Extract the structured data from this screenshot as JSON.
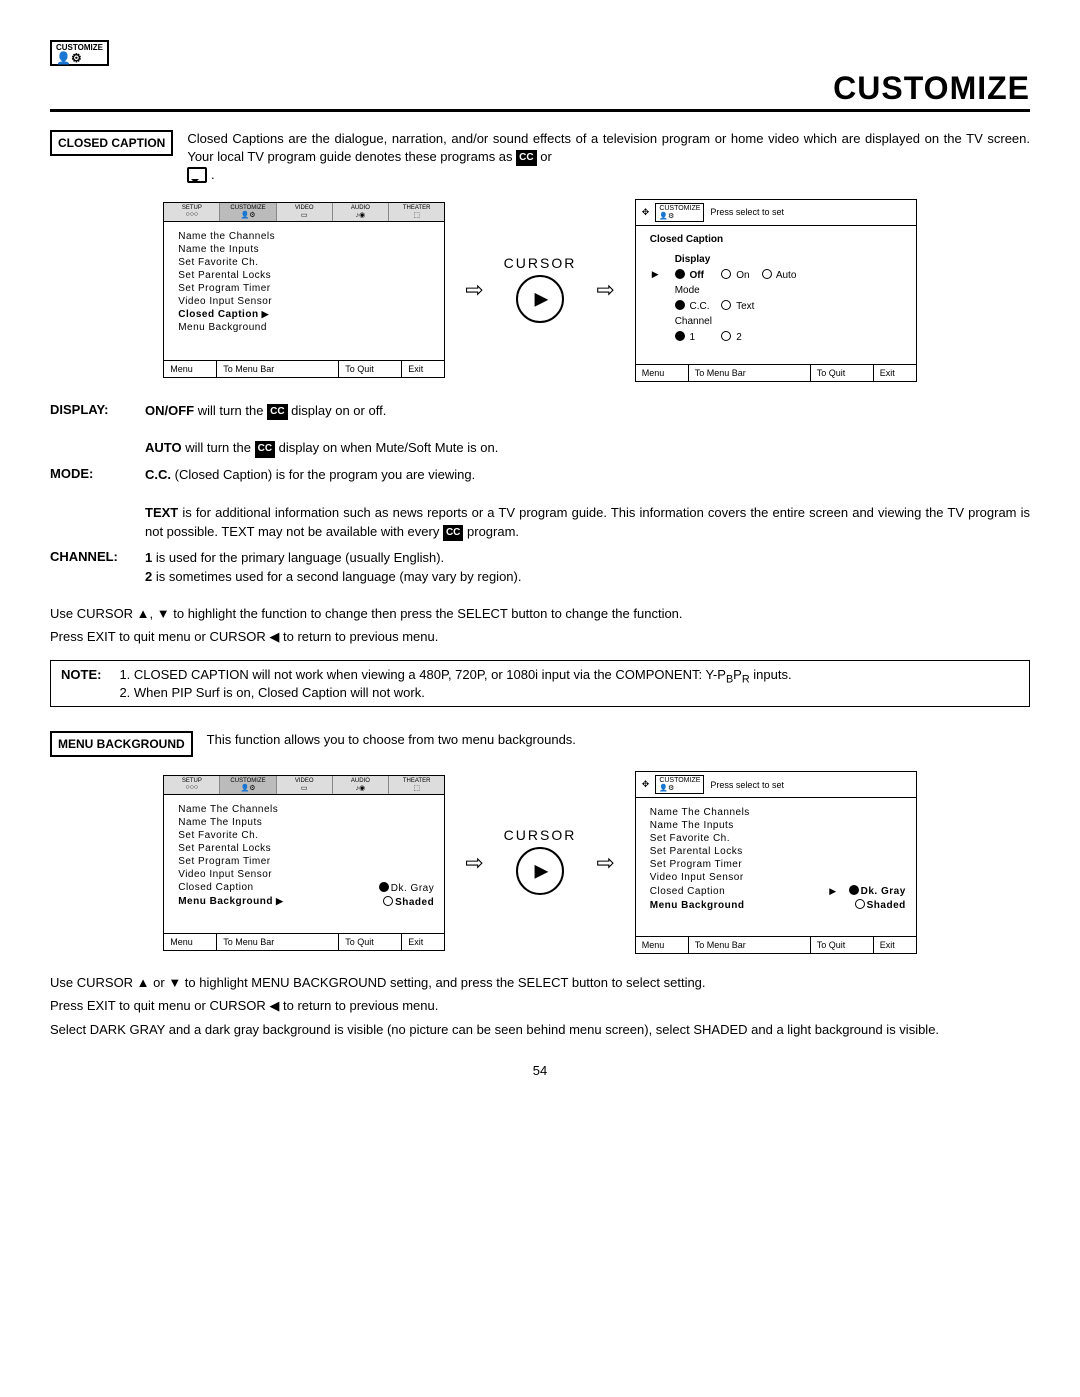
{
  "icon_label": "CUSTOMIZE",
  "page_title": "CUSTOMIZE",
  "cc_section_label": "CLOSED CAPTION",
  "cc_intro_1": "Closed Captions are the dialogue, narration, and/or sound effects of a television program or home video which are displayed on the TV screen.  Your local TV program guide denotes these programs as ",
  "cc_intro_or": " or ",
  "tabs": {
    "setup": "SETUP",
    "customize": "CUSTOMIZE",
    "video": "VIDEO",
    "audio": "AUDIO",
    "theater": "THEATER"
  },
  "menu_items": {
    "i0": "Name the Channels",
    "i1": "Name the Inputs",
    "i2": "Set Favorite Ch.",
    "i3": "Set Parental Locks",
    "i4": "Set Program Timer",
    "i5": "Video Input Sensor",
    "i6": "Closed Caption",
    "i7": "Menu Background"
  },
  "menu_items2": {
    "i0": "Name The Channels",
    "i1": "Name The Inputs",
    "i2": "Set Favorite Ch.",
    "i3": "Set Parental Locks",
    "i4": "Set Program Timer",
    "i5": "Video Input Sensor",
    "i6": "Closed Caption",
    "i7": "Menu Background"
  },
  "osd_foot": {
    "menu": "Menu",
    "bar": "To Menu Bar",
    "quit": "To Quit",
    "exit": "Exit"
  },
  "press_select": "Press select to set",
  "cc_title": "Closed Caption",
  "cc_opts": {
    "display": "Display",
    "off": "Off",
    "on": "On",
    "auto": "Auto",
    "mode": "Mode",
    "cc": "C.C.",
    "text": "Text",
    "channel": "Channel",
    "one": "1",
    "two": "2"
  },
  "cursor": "CURSOR",
  "defs": {
    "display_t": "DISPLAY:",
    "display_d1a": "ON/OFF",
    "display_d1b": " will turn the ",
    "display_d1c": " display on or off.",
    "display_d2a": "AUTO",
    "display_d2b": " will turn the ",
    "display_d2c": " display on when Mute/Soft Mute is on.",
    "mode_t": "MODE:",
    "mode_d1a": "C.C.",
    "mode_d1b": " (Closed Caption) is for the program you are viewing.",
    "mode_d2a": "TEXT",
    "mode_d2b": " is for additional information such as news reports or a TV program guide.  This information covers the entire screen and viewing the TV program is not possible.  TEXT may not be available with every ",
    "mode_d2c": " program.",
    "channel_t": "CHANNEL:",
    "channel_d1a": "1",
    "channel_d1b": " is used for the primary language (usually English).",
    "channel_d2a": "2",
    "channel_d2b": " is sometimes used for a second language (may vary by region)."
  },
  "cc_instr1": "Use CURSOR ▲, ▼ to highlight the function to change then press the SELECT button to change the function.",
  "cc_instr2": "Press EXIT to quit menu or CURSOR ◀ to return to previous menu.",
  "note_label": "NOTE:",
  "note1": "1.  CLOSED CAPTION will not work when viewing a 480P, 720P, or 1080i input via the COMPONENT: Y-P",
  "note1_sub": "B",
  "note1_mid": "P",
  "note1_sub2": "R",
  "note1_end": " inputs.",
  "note2": "2.  When PIP Surf is on, Closed Caption will not work.",
  "mb_label": "MENU BACKGROUND",
  "mb_intro": "This function allows you to choose from two menu backgrounds.",
  "bg_opts": {
    "dk": "Dk. Gray",
    "sh": "Shaded"
  },
  "mb_instr1": "Use CURSOR ▲ or ▼ to highlight MENU BACKGROUND setting, and press the SELECT button to select setting.",
  "mb_instr2": "Press EXIT to quit menu or CURSOR ◀ to return to previous menu.",
  "mb_instr3": "Select DARK GRAY and a dark gray background is visible (no picture can be seen behind menu screen), select SHADED and a light background is visible.",
  "page_number": "54"
}
